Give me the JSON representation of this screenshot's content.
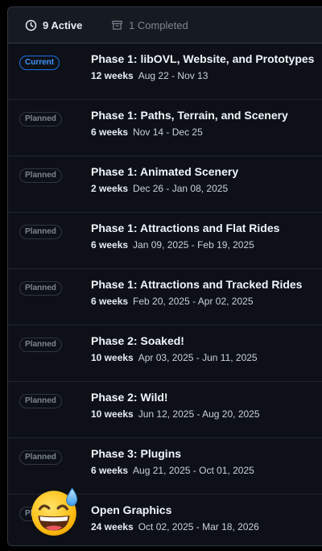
{
  "tabs": {
    "active": {
      "label": "9 Active",
      "icon": "clock-icon"
    },
    "completed": {
      "label": "1 Completed",
      "icon": "archive-icon"
    }
  },
  "milestones": [
    {
      "status": "Current",
      "title": "Phase 1: libOVL, Website, and Prototypes",
      "weeks": "12 weeks",
      "dates": "Aug 22 - Nov 13"
    },
    {
      "status": "Planned",
      "title": "Phase 1: Paths, Terrain, and Scenery",
      "weeks": "6 weeks",
      "dates": "Nov 14 - Dec 25"
    },
    {
      "status": "Planned",
      "title": "Phase 1: Animated Scenery",
      "weeks": "2 weeks",
      "dates": "Dec 26 - Jan 08, 2025"
    },
    {
      "status": "Planned",
      "title": "Phase 1: Attractions and Flat Rides",
      "weeks": "6 weeks",
      "dates": "Jan 09, 2025 - Feb 19, 2025"
    },
    {
      "status": "Planned",
      "title": "Phase 1: Attractions and Tracked Rides",
      "weeks": "6 weeks",
      "dates": "Feb 20, 2025 - Apr 02, 2025"
    },
    {
      "status": "Planned",
      "title": "Phase 2: Soaked!",
      "weeks": "10 weeks",
      "dates": "Apr 03, 2025 - Jun 11, 2025"
    },
    {
      "status": "Planned",
      "title": "Phase 2: Wild!",
      "weeks": "10 weeks",
      "dates": "Jun 12, 2025 - Aug 20, 2025"
    },
    {
      "status": "Planned",
      "title": "Phase 3: Plugins",
      "weeks": "6 weeks",
      "dates": "Aug 21, 2025 - Oct 01, 2025"
    },
    {
      "status": "Planned",
      "title": "Open Graphics",
      "weeks": "24 weeks",
      "dates": "Oct 02, 2025 - Mar 18, 2026"
    }
  ],
  "overlay_icon": "grinning-sweat-emoji-icon",
  "colors": {
    "background": "#0d1117",
    "border": "#30363d",
    "current_accent": "#4493f8",
    "muted": "#7d8590"
  }
}
